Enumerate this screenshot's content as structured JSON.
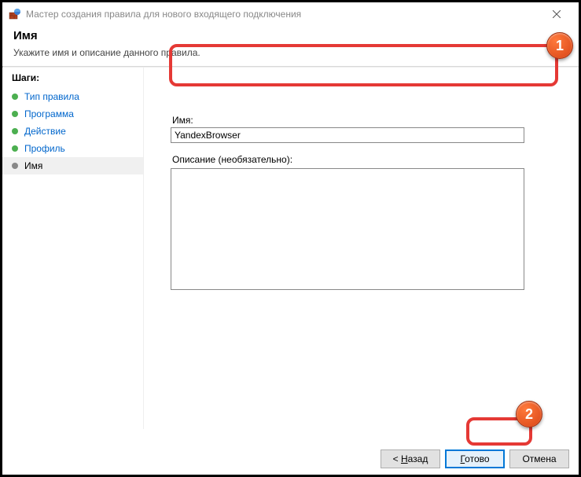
{
  "window": {
    "title": "Мастер создания правила для нового входящего подключения"
  },
  "header": {
    "title": "Имя",
    "subtitle": "Укажите имя и описание данного правила."
  },
  "sidebar": {
    "title": "Шаги:",
    "items": [
      {
        "label": "Тип правила"
      },
      {
        "label": "Программа"
      },
      {
        "label": "Действие"
      },
      {
        "label": "Профиль"
      },
      {
        "label": "Имя"
      }
    ]
  },
  "form": {
    "name_label": "Имя:",
    "name_value": "YandexBrowser",
    "desc_label": "Описание (необязательно):",
    "desc_value": ""
  },
  "buttons": {
    "back_prefix": "< ",
    "back_u": "Н",
    "back_rest": "азад",
    "finish_u": "Г",
    "finish_rest": "отово",
    "cancel": "Отмена"
  },
  "annotations": {
    "badge1": "1",
    "badge2": "2"
  }
}
